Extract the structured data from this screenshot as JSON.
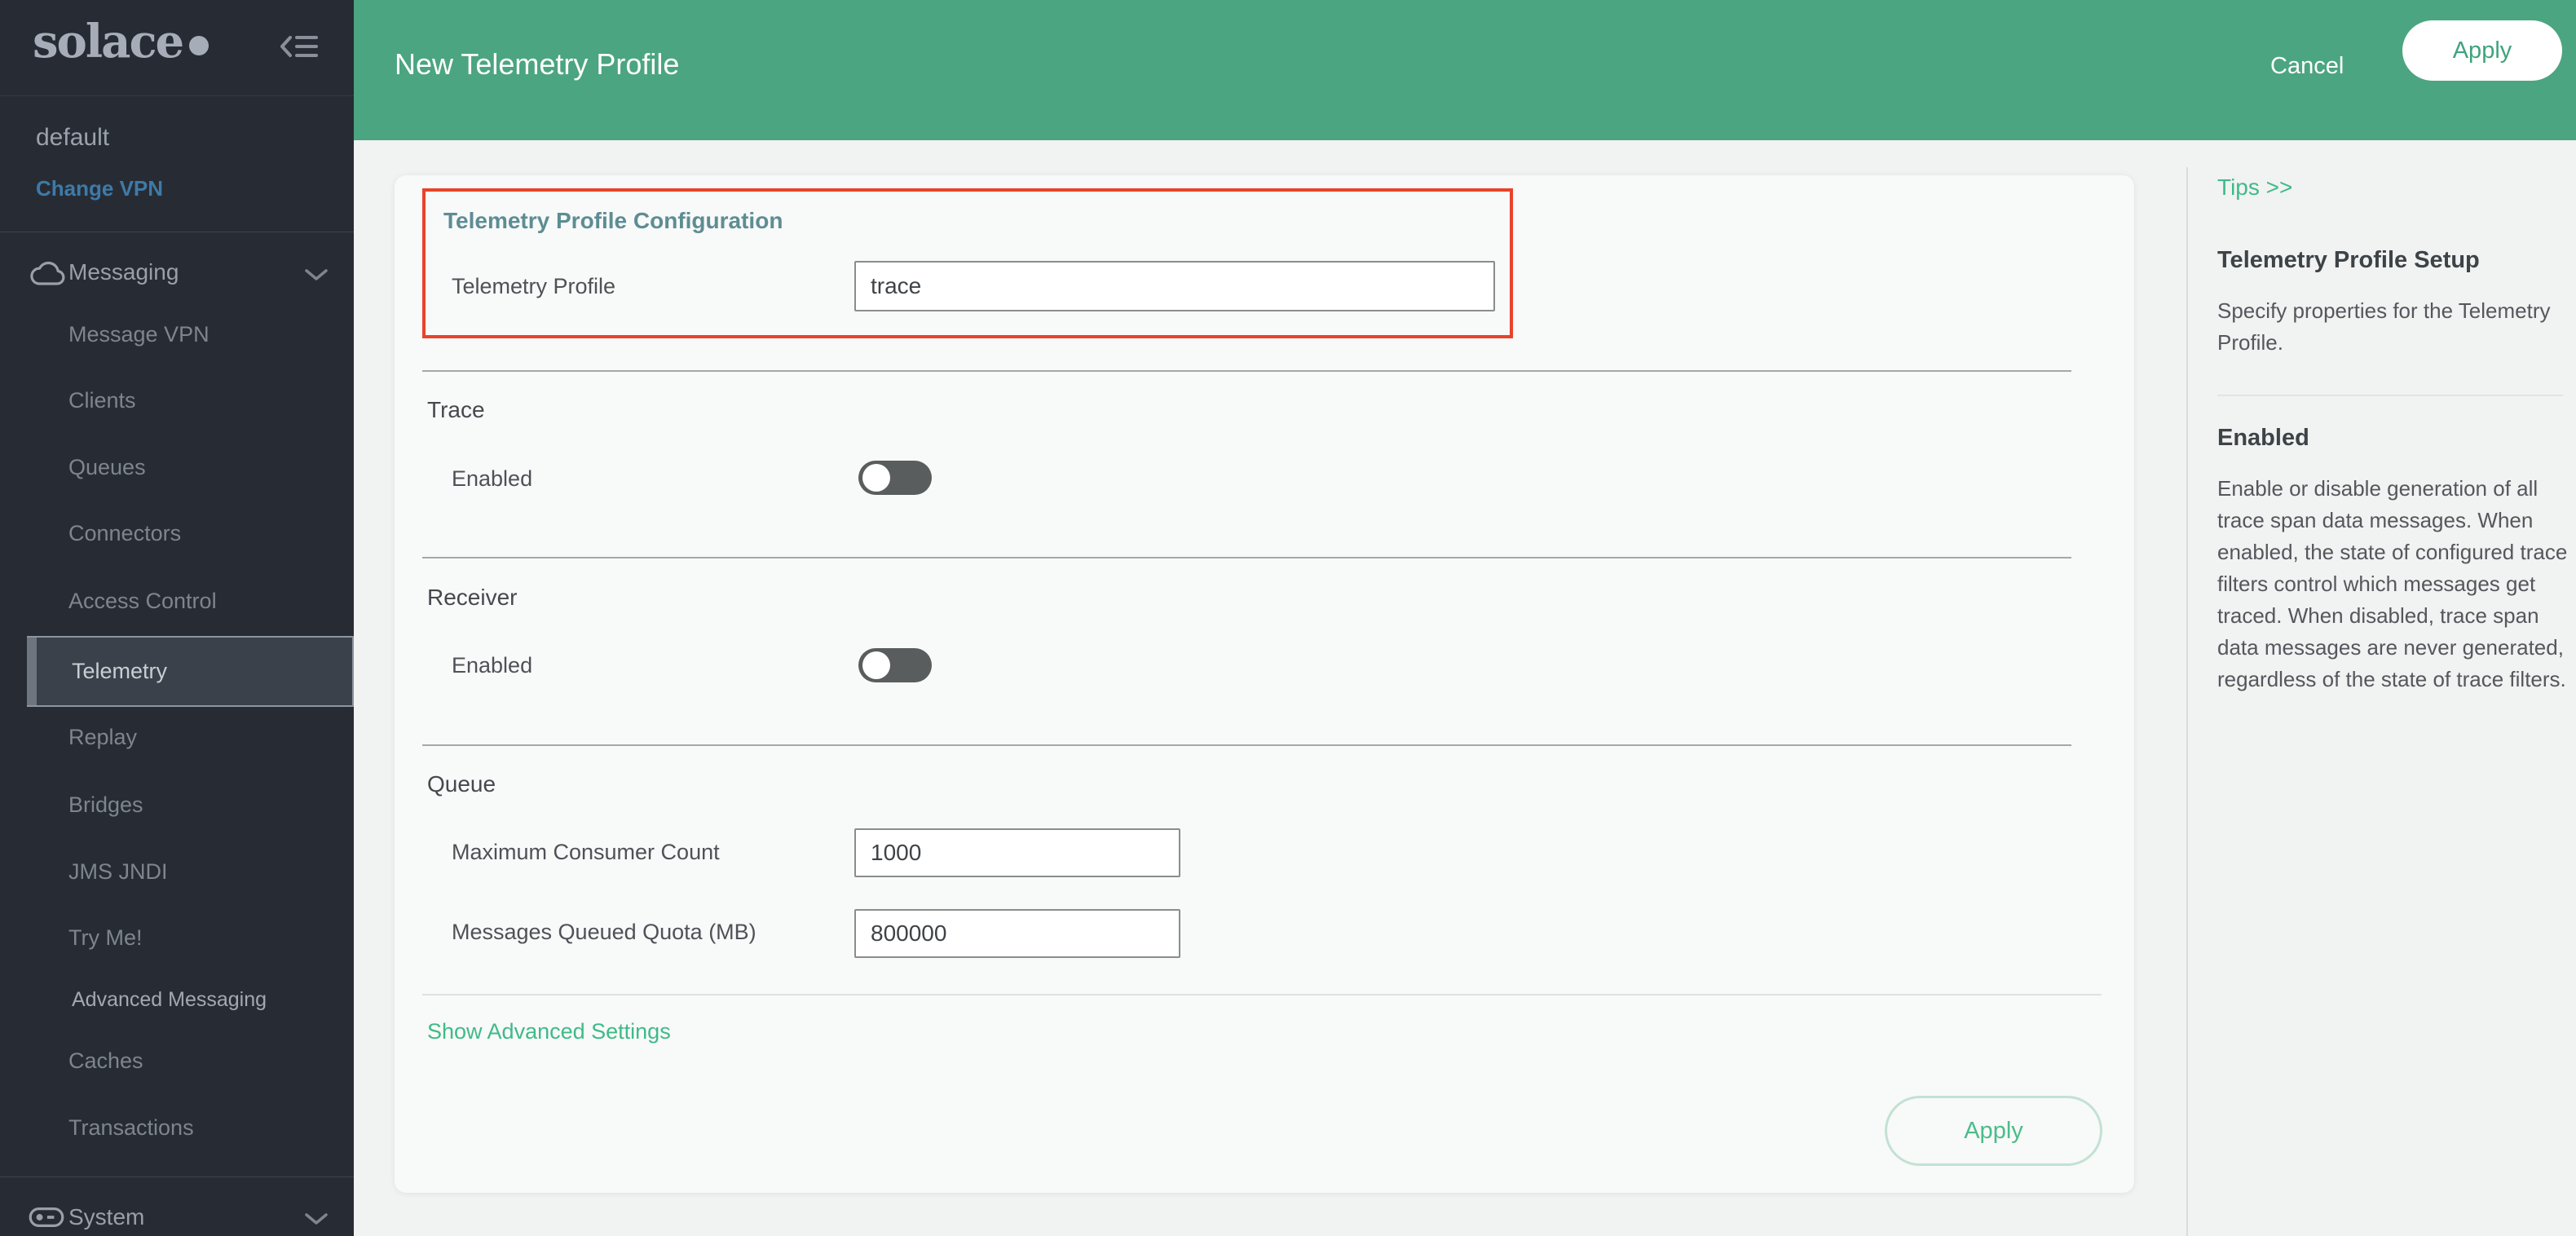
{
  "header": {
    "title": "New Telemetry Profile",
    "cancel_label": "Cancel",
    "apply_label": "Apply"
  },
  "sidebar": {
    "logo_text": "solace",
    "vpn_name": "default",
    "change_vpn_label": "Change VPN",
    "messaging_section": "Messaging",
    "system_section": "System",
    "items": [
      {
        "label": "Message VPN",
        "selected": false
      },
      {
        "label": "Clients",
        "selected": false
      },
      {
        "label": "Queues",
        "selected": false
      },
      {
        "label": "Connectors",
        "selected": false
      },
      {
        "label": "Access Control",
        "selected": false
      },
      {
        "label": "Telemetry",
        "selected": true
      },
      {
        "label": "Replay",
        "selected": false
      },
      {
        "label": "Bridges",
        "selected": false
      },
      {
        "label": "JMS JNDI",
        "selected": false
      },
      {
        "label": "Try Me!",
        "selected": false
      },
      {
        "label": "Advanced Messaging",
        "selected": false
      },
      {
        "label": "Caches",
        "selected": false
      },
      {
        "label": "Transactions",
        "selected": false
      }
    ]
  },
  "form": {
    "config_title": "Telemetry Profile Configuration",
    "profile_field": {
      "label": "Telemetry Profile",
      "value": "trace"
    },
    "trace": {
      "title": "Trace",
      "enabled_label": "Enabled",
      "enabled": false
    },
    "receiver": {
      "title": "Receiver",
      "enabled_label": "Enabled",
      "enabled": false
    },
    "queue": {
      "title": "Queue",
      "max_consumer": {
        "label": "Maximum Consumer Count",
        "value": "1000"
      },
      "quota": {
        "label": "Messages Queued Quota (MB)",
        "value": "800000"
      }
    },
    "show_advanced_label": "Show Advanced Settings",
    "apply_label": "Apply"
  },
  "tips": {
    "link_label": "Tips >>",
    "sections": [
      {
        "heading": "Telemetry Profile Setup",
        "body": "Specify properties for the Telemetry Profile."
      },
      {
        "heading": "Enabled",
        "body": "Enable or disable generation of all trace span data messages. When enabled, the state of configured trace filters control which messages get traced. When disabled, trace span data messages are never generated, regardless of the state of trace filters."
      }
    ]
  },
  "colors": {
    "header_green": "#4BA580",
    "accent_green": "#3EBB87",
    "highlight_red": "#E8432A",
    "sidebar_bg": "#272C34",
    "section_teal": "#5D8D93",
    "change_vpn_blue": "#3E7AA8"
  }
}
